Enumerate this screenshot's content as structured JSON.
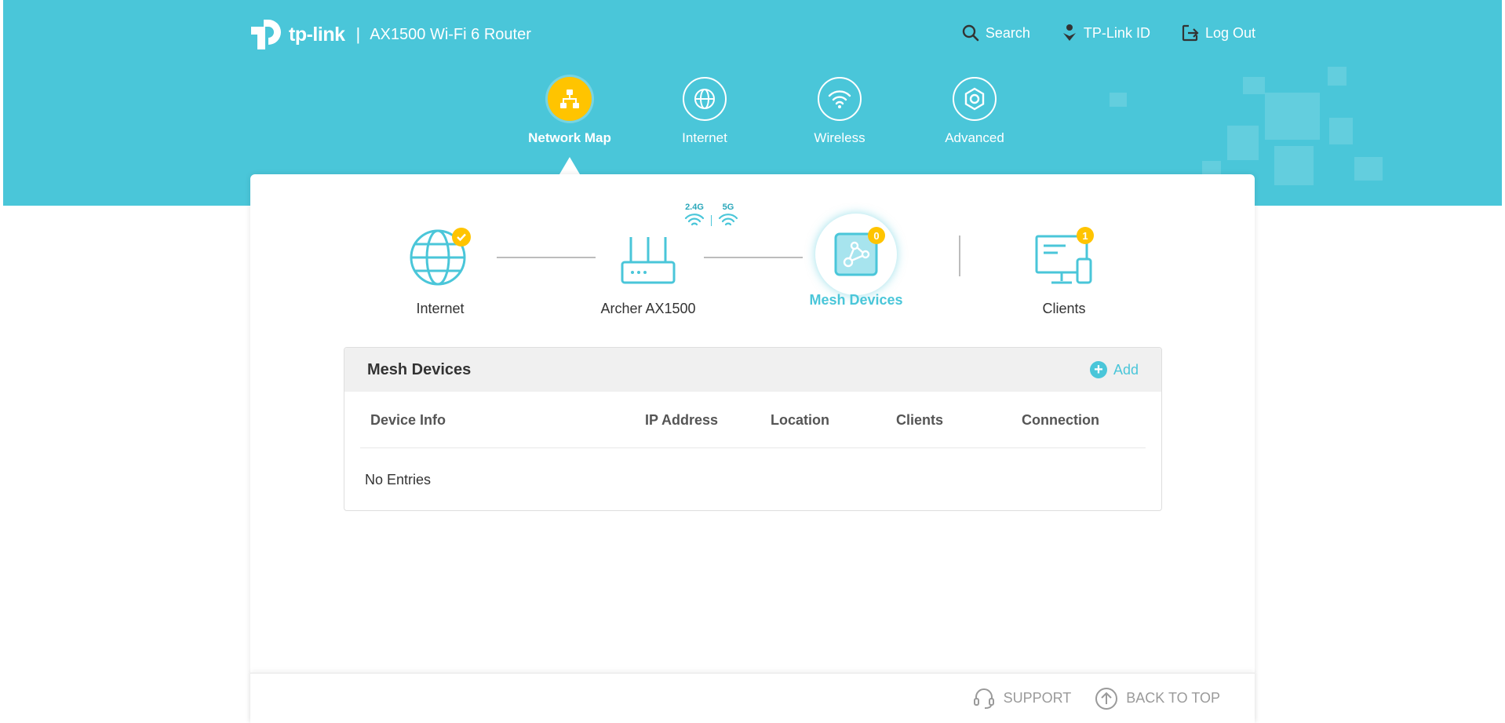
{
  "header": {
    "logo_text": "tp-link",
    "separator": "|",
    "model": "AX1500 Wi-Fi 6 Router",
    "links": [
      {
        "label": "Search",
        "icon": "search-icon"
      },
      {
        "label": "TP-Link ID",
        "icon": "tplink-id-icon"
      },
      {
        "label": "Log Out",
        "icon": "logout-icon"
      }
    ]
  },
  "nav": {
    "tabs": [
      {
        "label": "Network Map",
        "icon": "network-map-icon",
        "active": true
      },
      {
        "label": "Internet",
        "icon": "globe-icon",
        "active": false
      },
      {
        "label": "Wireless",
        "icon": "wifi-icon",
        "active": false
      },
      {
        "label": "Advanced",
        "icon": "gear-icon",
        "active": false
      }
    ]
  },
  "topology": {
    "internet": {
      "label": "Internet",
      "status": "connected"
    },
    "router": {
      "label": "Archer AX1500",
      "bands": [
        "2.4G",
        "5G"
      ]
    },
    "mesh": {
      "label": "Mesh Devices",
      "count": "0"
    },
    "clients": {
      "label": "Clients",
      "count": "1"
    }
  },
  "panel": {
    "title": "Mesh Devices",
    "add_label": "Add",
    "add_symbol": "+",
    "columns": [
      "Device Info",
      "IP Address",
      "Location",
      "Clients",
      "Connection"
    ],
    "empty_text": "No Entries"
  },
  "footer": {
    "support_label": "SUPPORT",
    "back_to_top_label": "BACK TO TOP"
  },
  "colors": {
    "brand": "#4ac6d9",
    "accent": "#ffc400"
  }
}
